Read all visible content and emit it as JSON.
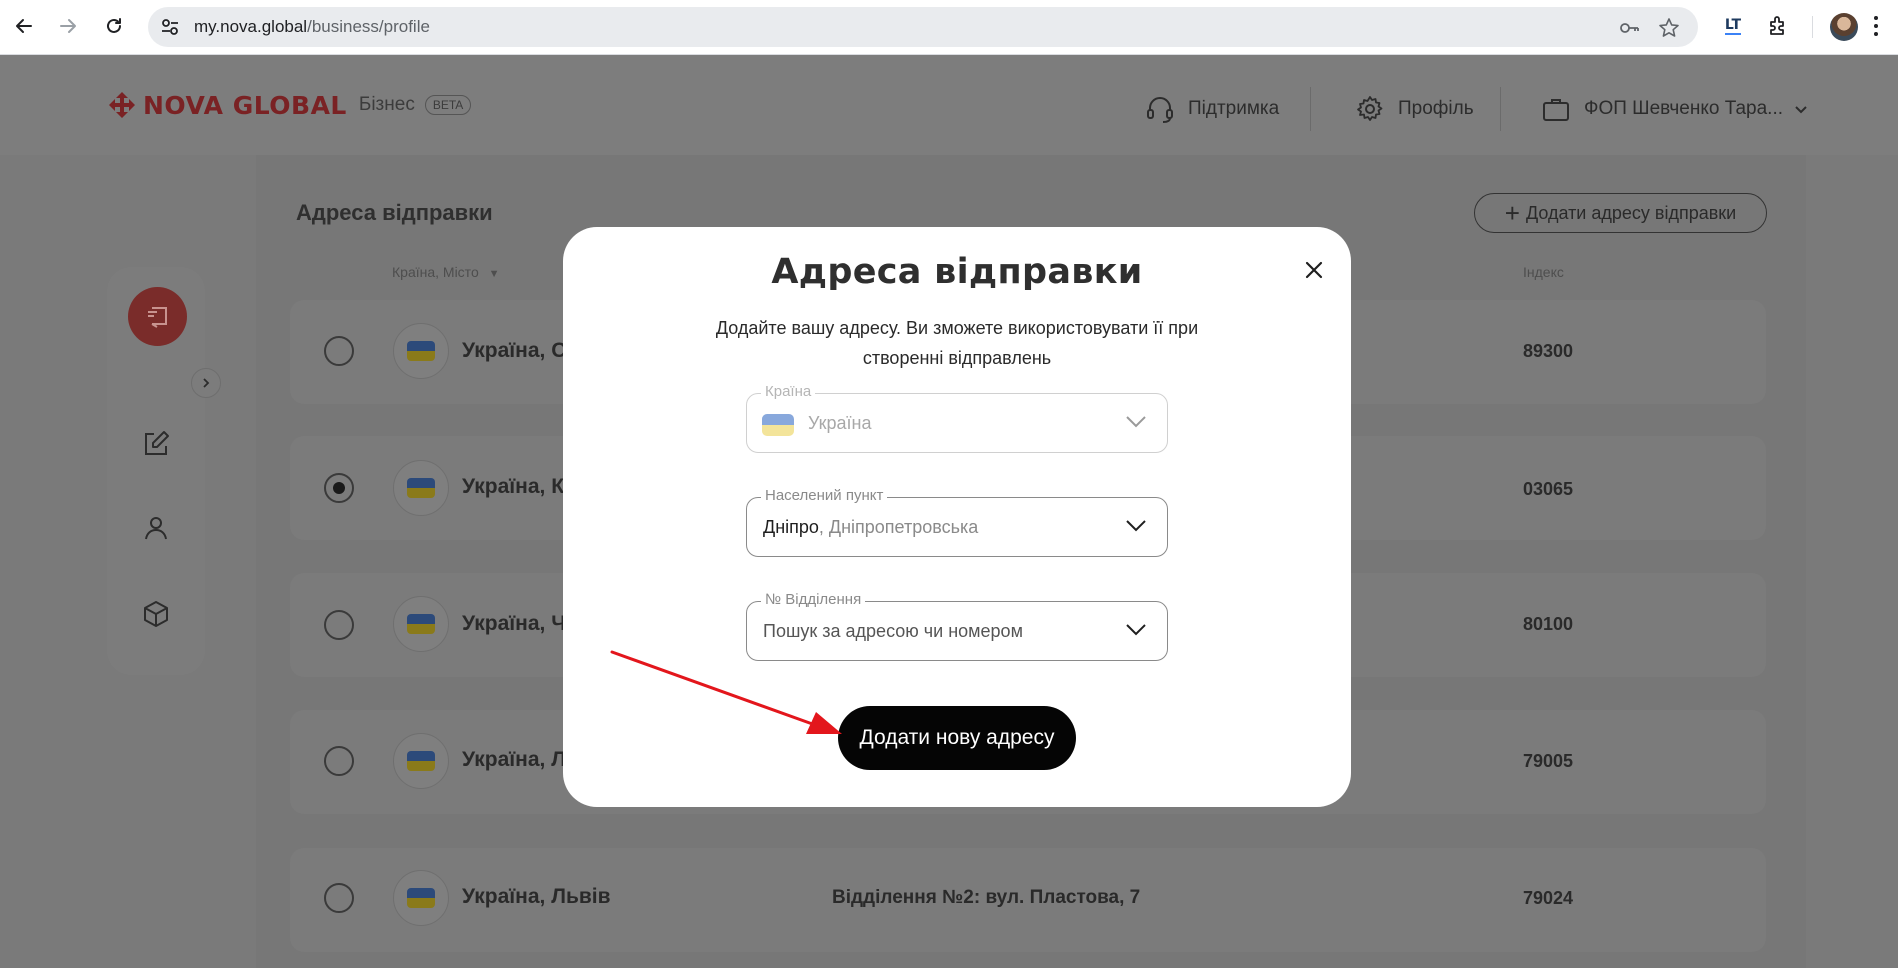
{
  "browser": {
    "url_host": "my.nova.global",
    "url_path": "/business/profile",
    "extension_label": "LT"
  },
  "header": {
    "logo_text": "NOVA GLOBAL",
    "business_label": "Бізнес",
    "beta_badge": "BETA",
    "support_label": "Підтримка",
    "profile_label": "Профіль",
    "account_label": "ФОП Шевченко Тара..."
  },
  "page": {
    "title": "Адреса відправки",
    "add_button_label": "Додати адресу відправки",
    "columns": {
      "country_city": "Країна, Місто",
      "sort_arrow": "▼",
      "index": "Індекс"
    },
    "rows": [
      {
        "city": "Україна, С",
        "branch": "",
        "index": "89300",
        "selected": false
      },
      {
        "city": "Україна, К",
        "branch": "",
        "index": "03065",
        "selected": true
      },
      {
        "city": "Україна, Ч",
        "branch": "",
        "index": "80100",
        "selected": false
      },
      {
        "city": "Україна, Л",
        "branch": "",
        "index": "79005",
        "selected": false
      },
      {
        "city": "Україна, Львів",
        "branch": "Відділення №2: вул. Пластова, 7",
        "index": "79024",
        "selected": false
      }
    ]
  },
  "modal": {
    "title": "Адреса відправки",
    "subtitle": "Додайте вашу адресу. Ви зможете використовувати її при створенні відправлень",
    "country": {
      "label": "Країна",
      "value": "Україна"
    },
    "city": {
      "label": "Населений пункт",
      "value": "Дніпро",
      "region": ", Дніпропетровська"
    },
    "branch": {
      "label": "№ Відділення",
      "placeholder": "Пошук за адресою чи номером"
    },
    "submit_label": "Додати нову адресу"
  },
  "colors": {
    "brand_red": "#d7282f",
    "button_black": "#050505",
    "annotation_arrow": "#e3161c"
  }
}
